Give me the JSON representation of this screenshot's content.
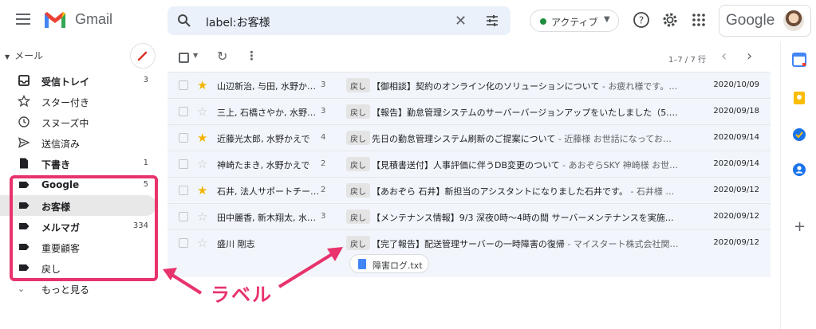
{
  "app": {
    "name": "Gmail"
  },
  "search": {
    "value": "label:お客様"
  },
  "status": {
    "label": "アクティブ"
  },
  "account": {
    "brand": "Google"
  },
  "sidebar": {
    "section_label": "メール",
    "items": [
      {
        "label": "受信トレイ",
        "count": "3",
        "icon": "inbox-icon",
        "bold": true
      },
      {
        "label": "スター付き",
        "count": "",
        "icon": "star-icon",
        "bold": false
      },
      {
        "label": "スヌーズ中",
        "count": "",
        "icon": "clock-icon",
        "bold": false
      },
      {
        "label": "送信済み",
        "count": "",
        "icon": "send-icon",
        "bold": false
      },
      {
        "label": "下書き",
        "count": "1",
        "icon": "draft-icon",
        "bold": true
      },
      {
        "label": "Google",
        "count": "5",
        "icon": "label-icon",
        "bold": true
      },
      {
        "label": "お客様",
        "count": "",
        "icon": "label-icon",
        "bold": true
      },
      {
        "label": "メルマガ",
        "count": "334",
        "icon": "label-icon",
        "bold": true
      },
      {
        "label": "重要顧客",
        "count": "",
        "icon": "label-icon",
        "bold": false
      },
      {
        "label": "戻し",
        "count": "",
        "icon": "label-icon",
        "bold": false
      }
    ],
    "more_label": "もっと見る"
  },
  "toolbar": {
    "range": "1–7 / 7 行"
  },
  "emails": [
    {
      "sender": "山辺新治, 与田, 水野か…",
      "count": "3",
      "starred": true,
      "tag": "戻し",
      "subject": "【御相談】契約のオンライン化のソリューションについて",
      "snippet": " - お疲れ様です。…",
      "date": "2020/10/09"
    },
    {
      "sender": "三上, 石橋さやか, 水野…",
      "count": "3",
      "starred": false,
      "tag": "戻し",
      "subject": "【報告】勤怠管理システムのサーバーバージョンアップをいたしました（5.…",
      "snippet": "",
      "date": "2020/09/18"
    },
    {
      "sender": "近藤光太郎, 水野かえで",
      "count": "4",
      "starred": true,
      "tag": "戻し",
      "subject": "先日の勤怠管理システム刷新のご提案について",
      "snippet": " - 近藤様 お世話になってお…",
      "date": "2020/09/14"
    },
    {
      "sender": "神崎たまき, 水野かえで",
      "count": "2",
      "starred": false,
      "tag": "戻し",
      "subject": "【見積書送付】人事評価に伴うDB変更のついて",
      "snippet": " - あおぞらSKY 神崎様 お世…",
      "date": "2020/09/14"
    },
    {
      "sender": "石井, 法人サポートチー…",
      "count": "2",
      "starred": true,
      "tag": "戻し",
      "subject": "【あおぞら 石井】新担当のアシスタントになりました石井です。",
      "snippet": " - 石井様 …",
      "date": "2020/09/12"
    },
    {
      "sender": "田中麗香, 新木翔太, 水…",
      "count": "3",
      "starred": false,
      "tag": "戻し",
      "subject": "【メンテナンス情報】9/3 深夜0時〜4時の間 サーバーメンテナンスを実施…",
      "snippet": "",
      "date": "2020/09/12"
    },
    {
      "sender": "盛川 剛志",
      "count": "",
      "starred": false,
      "tag": "戻し",
      "subject": "【完了報告】配送管理サーバーの一時障害の復帰",
      "snippet": " - マイスタート株式会社関…",
      "date": "2020/09/12",
      "attachment": "障害ログ.txt"
    }
  ],
  "annotation": {
    "text": "ラベル"
  },
  "colors": {
    "highlight": "#e8336d",
    "star": "#f4b400",
    "accent": "#1a73e8"
  }
}
